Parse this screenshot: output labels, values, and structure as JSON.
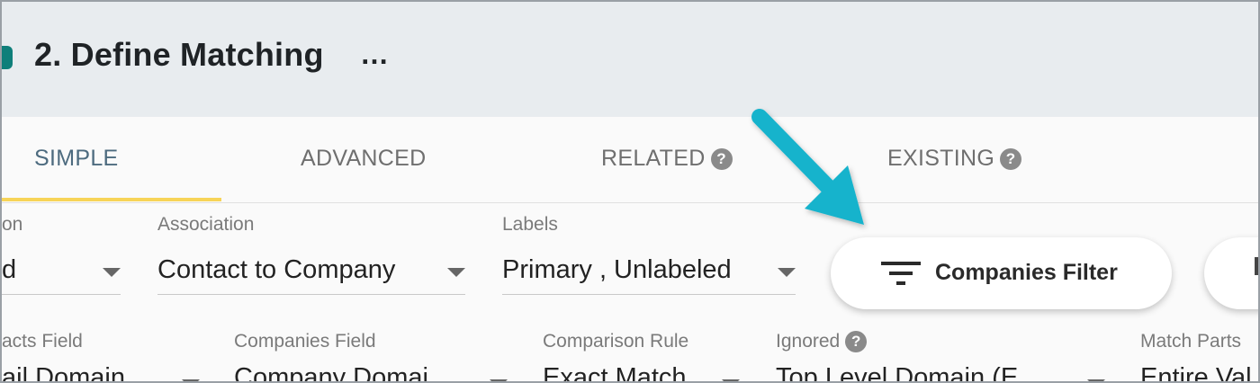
{
  "header": {
    "title": "2. Define Matching",
    "more_label": "…"
  },
  "tabs": [
    {
      "label": "SIMPLE",
      "active": true,
      "help": false
    },
    {
      "label": "ADVANCED",
      "active": false,
      "help": false
    },
    {
      "label": "RELATED",
      "active": false,
      "help": true
    },
    {
      "label": "EXISTING",
      "active": false,
      "help": true
    }
  ],
  "help_glyph": "?",
  "row1": {
    "partial_label": "on",
    "partial_value": "d",
    "association_label": "Association",
    "association_value": "Contact to Company",
    "labels_label": "Labels",
    "labels_value": "Primary , Unlabeled",
    "filter_button": "Companies Filter"
  },
  "row2": {
    "contacts_field_label": "acts Field",
    "contacts_field_value": "ail Domain",
    "companies_field_label": "Companies Field",
    "companies_field_value": "Company Domai",
    "comparison_rule_label": "Comparison Rule",
    "comparison_rule_value": "Exact Match",
    "ignored_label": "Ignored",
    "ignored_value": "Top Level Domain (E",
    "match_parts_label": "Match Parts",
    "match_parts_value": "Entire Val"
  },
  "colors": {
    "accent": "#0f7f7a",
    "tab_active": "#4d6b7f",
    "underline": "#f7d458",
    "arrow": "#17b3cc"
  }
}
